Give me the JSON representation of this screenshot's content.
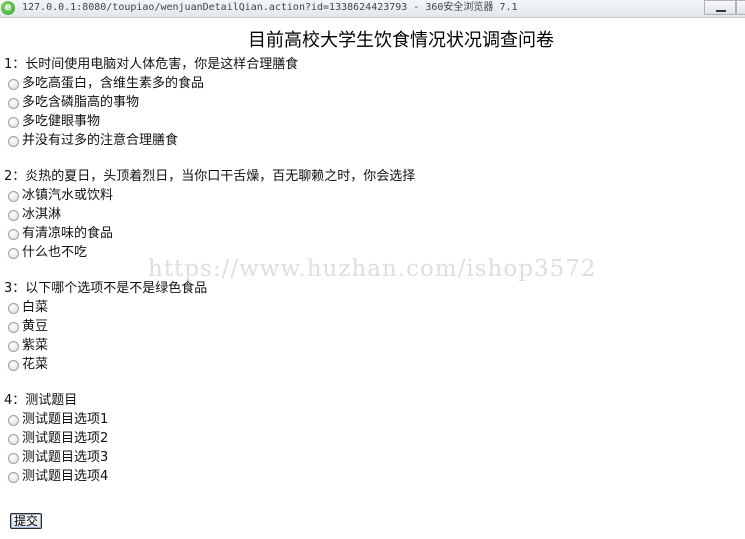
{
  "window": {
    "app_icon": "e",
    "title": "127.0.0.1:8080/toupiao/wenjuanDetailQian.action?id=1338624423793 - 360安全浏览器 7.1"
  },
  "page_title": "目前高校大学生饮食情况状况调查问卷",
  "questions": [
    {
      "text": "1：长时间使用电脑对人体危害，你是这样合理膳食",
      "options": [
        "多吃高蛋白，含维生素多的食品",
        "多吃含磷脂高的事物",
        "多吃健眼事物",
        "并没有过多的注意合理膳食"
      ]
    },
    {
      "text": "2：炎热的夏日，头顶着烈日，当你口干舌燥，百无聊赖之时，你会选择",
      "options": [
        "冰镇汽水或饮料",
        "冰淇淋",
        "有清凉味的食品",
        "什么也不吃"
      ]
    },
    {
      "text": "3：以下哪个选项不是不是绿色食品",
      "options": [
        "白菜",
        "黄豆",
        "紫菜",
        "花菜"
      ]
    },
    {
      "text": "4：测试题目",
      "options": [
        "测试题目选项1",
        "测试题目选项2",
        "测试题目选项3",
        "测试题目选项4"
      ]
    }
  ],
  "submit_label": "提交",
  "watermark": "https://www.huzhan.com/ishop3572"
}
